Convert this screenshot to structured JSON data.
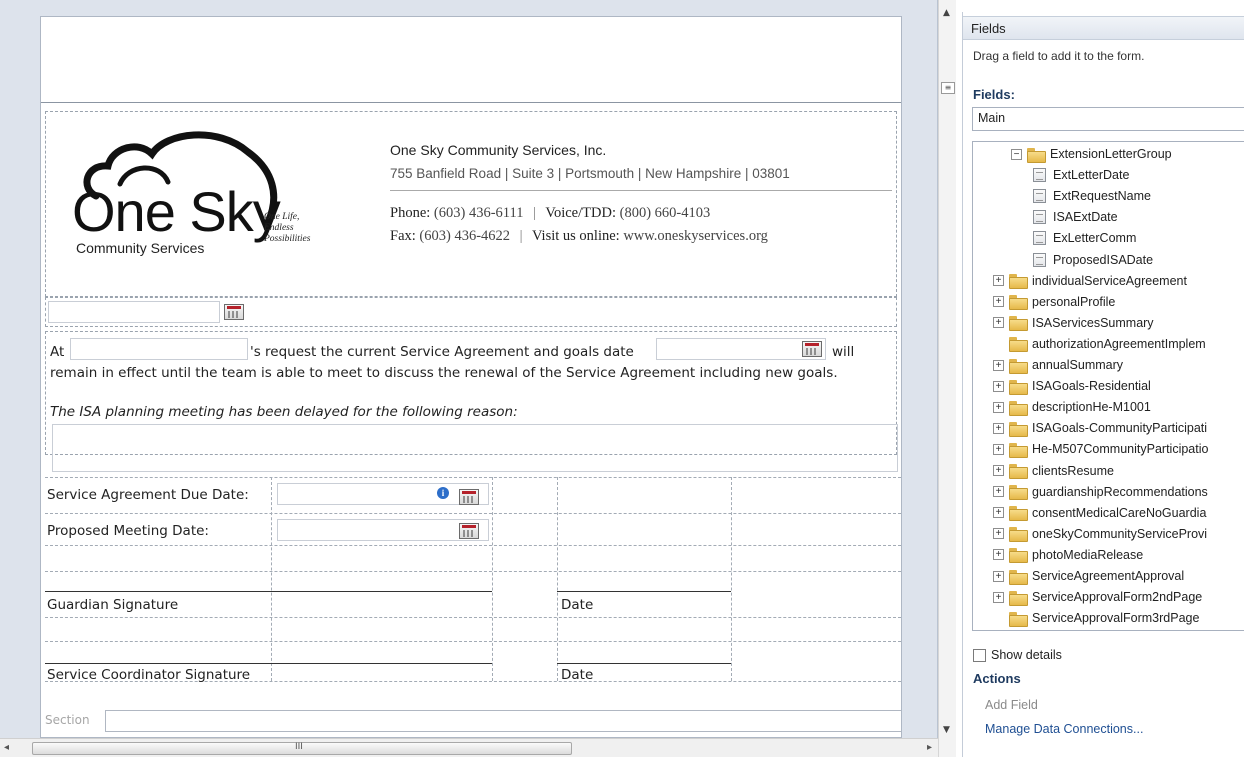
{
  "designer": {
    "logo": {
      "main": "One Sky",
      "sub": "Community Services",
      "tagline_1": "One Life,",
      "tagline_2": "Endless",
      "tagline_3": "Possibilities"
    },
    "org": {
      "name": "One Sky Community Services, Inc.",
      "address": "755 Banfield Road  |  Suite 3  |  Portsmouth  |  New Hampshire  |  03801",
      "phone_label": "Phone:",
      "phone": "(603) 436-6111",
      "voice_label": "Voice/TDD:",
      "voice": "(800) 660-4103",
      "fax_label": "Fax:",
      "fax": "(603) 436-4622",
      "web_label": "Visit us online:",
      "web": "www.oneskyservices.org",
      "sep": "|"
    },
    "paragraph": {
      "at": "At",
      "request_text": "'s request the current Service Agreement and goals date",
      "will": "will",
      "line2": "remain in effect until the team is able to meet to discuss the renewal of the Service Agreement including new goals.",
      "reason": "The ISA planning meeting has been delayed for the following reason:"
    },
    "grid": {
      "due_date_label": "Service Agreement Due Date:",
      "meeting_date_label": "Proposed Meeting Date:",
      "guardian_sig": "Guardian Signature",
      "coordinator_sig": "Service Coordinator Signature",
      "date_label_1": "Date",
      "date_label_2": "Date"
    },
    "section_label": "Section",
    "scroll_grip": "III"
  },
  "pane": {
    "title": "Fields",
    "hint": "Drag a field to add it to the form.",
    "fields_heading": "Fields:",
    "fields_select": "Main",
    "tree": [
      {
        "label": "ExtensionLetterGroup",
        "type": "folder",
        "expander": "−",
        "level": 1
      },
      {
        "label": "ExtLetterDate",
        "type": "field",
        "level": 2
      },
      {
        "label": "ExtRequestName",
        "type": "field",
        "level": 2
      },
      {
        "label": "ISAExtDate",
        "type": "field",
        "level": 2
      },
      {
        "label": "ExLetterComm",
        "type": "field",
        "level": 2
      },
      {
        "label": "ProposedISADate",
        "type": "field",
        "level": 2
      },
      {
        "label": "individualServiceAgreement",
        "type": "folder",
        "expander": "+",
        "level": 0
      },
      {
        "label": "personalProfile",
        "type": "folder",
        "expander": "+",
        "level": 0
      },
      {
        "label": "ISAServicesSummary",
        "type": "folder",
        "expander": "+",
        "level": 0
      },
      {
        "label": "authorizationAgreementImplem",
        "type": "folder",
        "expander": "",
        "level": 0
      },
      {
        "label": "annualSummary",
        "type": "folder",
        "expander": "+",
        "level": 0
      },
      {
        "label": "ISAGoals-Residential",
        "type": "folder",
        "expander": "+",
        "level": 0
      },
      {
        "label": "descriptionHe-M1001",
        "type": "folder",
        "expander": "+",
        "level": 0
      },
      {
        "label": "ISAGoals-CommunityParticipati",
        "type": "folder",
        "expander": "+",
        "level": 0
      },
      {
        "label": "He-M507CommunityParticipatio",
        "type": "folder",
        "expander": "+",
        "level": 0
      },
      {
        "label": "clientsResume",
        "type": "folder",
        "expander": "+",
        "level": 0
      },
      {
        "label": "guardianshipRecommendations",
        "type": "folder",
        "expander": "+",
        "level": 0
      },
      {
        "label": "consentMedicalCareNoGuardia",
        "type": "folder",
        "expander": "+",
        "level": 0
      },
      {
        "label": "oneSkyCommunityServiceProvi",
        "type": "folder",
        "expander": "+",
        "level": 0
      },
      {
        "label": "photoMediaRelease",
        "type": "folder",
        "expander": "+",
        "level": 0
      },
      {
        "label": "ServiceAgreementApproval",
        "type": "folder",
        "expander": "+",
        "level": 0
      },
      {
        "label": "ServiceApprovalForm2ndPage",
        "type": "folder",
        "expander": "+",
        "level": 0
      },
      {
        "label": "ServiceApprovalForm3rdPage",
        "type": "folder",
        "expander": "",
        "level": 0
      }
    ],
    "show_details": "Show details",
    "actions_heading": "Actions",
    "add_field": "Add Field",
    "manage_connections": "Manage Data Connections..."
  }
}
